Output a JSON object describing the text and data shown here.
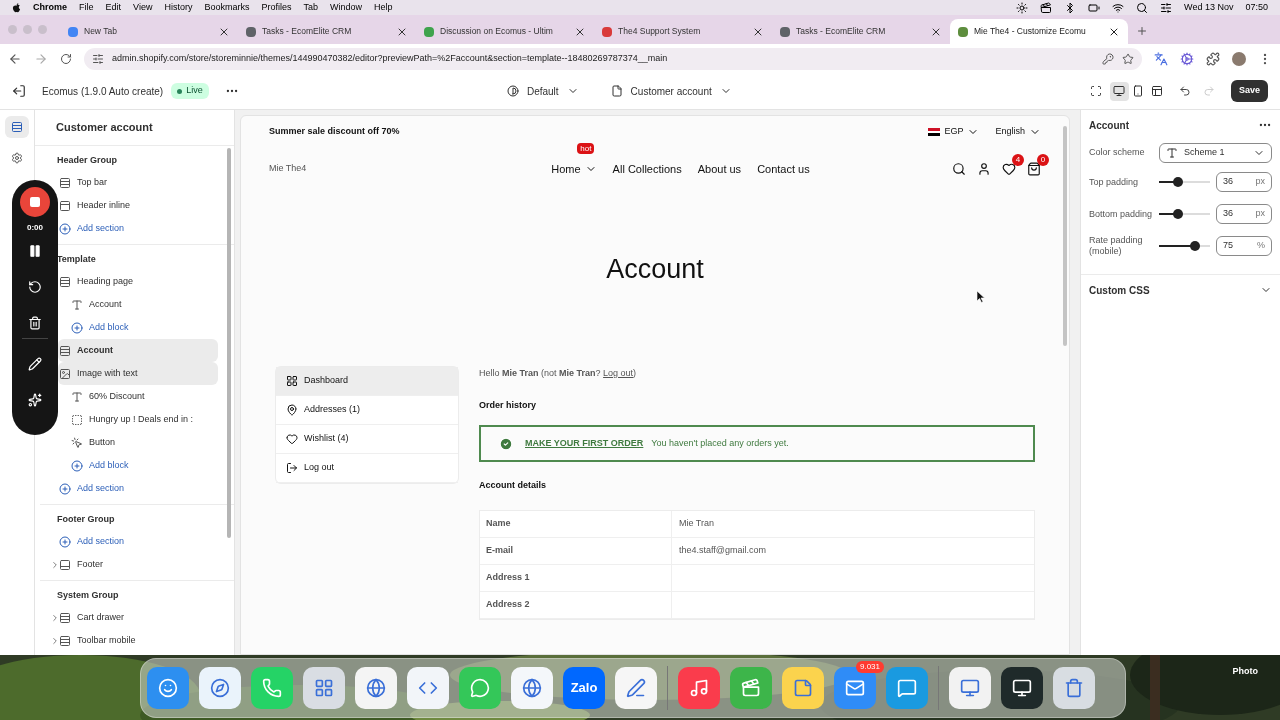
{
  "menubar": {
    "app": "Chrome",
    "menus": [
      "File",
      "Edit",
      "View",
      "History",
      "Bookmarks",
      "Profiles",
      "Tab",
      "Window",
      "Help"
    ],
    "date": "Wed 13 Nov",
    "time": "07:50"
  },
  "tabs": [
    {
      "title": "New Tab",
      "color": "#4285f4",
      "selected": false
    },
    {
      "title": "Tasks - EcomElite CRM",
      "color": "#5f6368",
      "selected": false
    },
    {
      "title": "Discussion on Ecomus - Ultim",
      "color": "#3fa34d",
      "selected": false
    },
    {
      "title": "The4 Support System",
      "color": "#d93a3a",
      "selected": false
    },
    {
      "title": "Tasks - EcomElite CRM",
      "color": "#5f6368",
      "selected": false
    },
    {
      "title": "Mie The4 - Customize Ecomu",
      "color": "#5e8e3e",
      "selected": true
    }
  ],
  "address_bar": {
    "url": "admin.shopify.com/store/storeminnie/themes/144990470382/editor?previewPath=%2Faccount&section=template--18480269787374__main"
  },
  "editor_bar": {
    "theme": "Ecomus (1.9.0 Auto create)",
    "status": "Live",
    "variant": "Default",
    "template": "Customer account",
    "save": "Save",
    "devices": [
      {
        "kind": "desktop",
        "selected": true
      },
      {
        "kind": "mobile",
        "selected": false
      },
      {
        "kind": "fullwidth",
        "selected": false
      }
    ],
    "undo": {
      "disabled": false
    },
    "redo": {
      "disabled": true
    }
  },
  "rail": [
    {
      "kind": "sections",
      "selected": true
    },
    {
      "kind": "settings",
      "selected": false
    }
  ],
  "recorder": {
    "time": "0:00"
  },
  "sidebar": {
    "title": "Customer account",
    "groups": [
      {
        "title": "Header Group",
        "items": [
          {
            "kind": "section",
            "label": "Top bar",
            "selected": false
          },
          {
            "kind": "header",
            "label": "Header inline",
            "selected": false
          },
          {
            "kind": "add",
            "label": "Add section",
            "selected": false
          }
        ]
      },
      {
        "title": "Template",
        "items": [
          {
            "kind": "section",
            "label": "Heading page",
            "selected": false,
            "children": [
              {
                "kind": "text",
                "label": "Account",
                "selected": false
              },
              {
                "kind": "add",
                "label": "Add block",
                "selected": false
              }
            ]
          },
          {
            "kind": "section",
            "label": "Account",
            "selected": true
          },
          {
            "kind": "imagetext",
            "label": "Image with text",
            "selected": true,
            "children": [
              {
                "kind": "text",
                "label": "60% Discount",
                "selected": false
              },
              {
                "kind": "timer",
                "label": "Hungry up ! Deals end in :",
                "selected": false
              },
              {
                "kind": "button",
                "label": "Button",
                "selected": false
              },
              {
                "kind": "add",
                "label": "Add block",
                "selected": false
              }
            ]
          },
          {
            "kind": "add",
            "label": "Add section",
            "selected": false
          }
        ]
      },
      {
        "title": "Footer Group",
        "items": [
          {
            "kind": "add",
            "label": "Add section",
            "selected": false
          },
          {
            "kind": "footer",
            "label": "Footer",
            "selected": false,
            "expanded": false
          }
        ]
      },
      {
        "title": "System Group",
        "items": [
          {
            "kind": "section",
            "label": "Cart drawer",
            "selected": false,
            "expanded": false
          },
          {
            "kind": "section",
            "label": "Toolbar mobile",
            "selected": false,
            "expanded": false
          }
        ]
      }
    ]
  },
  "store": {
    "announcement": "Summer sale discount off 70%",
    "currency": "EGP",
    "language": "English",
    "logo": "Mie The4",
    "nav": [
      {
        "label": "Home",
        "badge": "hot",
        "dropdown": true
      },
      {
        "label": "All Collections",
        "dropdown": false
      },
      {
        "label": "About us",
        "dropdown": false
      },
      {
        "label": "Contact us",
        "dropdown": false
      }
    ],
    "wishlist_count": "4",
    "cart_count": "0",
    "page_title": "Account",
    "account_menu": [
      {
        "kind": "dashboard",
        "label": "Dashboard",
        "selected": true
      },
      {
        "kind": "addresses",
        "label": "Addresses (1)",
        "selected": false
      },
      {
        "kind": "wishlist",
        "label": "Wishlist (4)",
        "selected": false
      },
      {
        "kind": "logout",
        "label": "Log out",
        "selected": false
      }
    ],
    "greeting": {
      "text": "Hello **Mie Tran** (not **Mie Tran**? ",
      "link": "Log out",
      "end": ")"
    },
    "order_history": {
      "title": "Order history",
      "link": "MAKE YOUR FIRST ORDER",
      "message": "You haven't placed any orders yet."
    },
    "details": {
      "title": "Account details",
      "rows": [
        {
          "label": "Name",
          "value": "Mie Tran"
        },
        {
          "label": "E-mail",
          "value": "the4.staff@gmail.com"
        },
        {
          "label": "Address 1"
        },
        {
          "label": "Address 2"
        }
      ]
    }
  },
  "settings": {
    "title": "Account",
    "color_scheme": {
      "label": "Color scheme",
      "value": "Scheme 1"
    },
    "sliders": [
      {
        "label": "Top padding",
        "value": "36",
        "unit": "px",
        "level": 0.37
      },
      {
        "label": "Bottom padding",
        "value": "36",
        "unit": "px",
        "level": 0.37
      },
      {
        "label": "Rate padding (mobile)",
        "value": "75",
        "unit": "%",
        "level": 0.7
      }
    ],
    "custom_css": {
      "label": "Custom CSS",
      "expanded": false
    }
  },
  "dock": [
    {
      "kind": "finder",
      "color": "#2d8ff0"
    },
    {
      "kind": "safari",
      "color": "#eaf3fb"
    },
    {
      "kind": "whatsapp",
      "color": "#25d366"
    },
    {
      "kind": "launchpad",
      "color": "#d9dde3"
    },
    {
      "kind": "chrome",
      "color": "#f4f4f4"
    },
    {
      "kind": "vscode",
      "color": "#f2f5f9"
    },
    {
      "kind": "messages",
      "color": "#34c759"
    },
    {
      "kind": "edge",
      "color": "#f4f7fa"
    },
    {
      "kind": "zalo",
      "color": "#0068ff",
      "label": "Zalo"
    },
    {
      "kind": "freeform",
      "color": "#f6f6f6"
    },
    {
      "kind": "separator"
    },
    {
      "kind": "music",
      "color": "#fa3c4c"
    },
    {
      "kind": "camtasia",
      "color": "#3db54a"
    },
    {
      "kind": "notes",
      "color": "#fbd34d"
    },
    {
      "kind": "mail",
      "color": "#2f8cf7",
      "badge": "9.031"
    },
    {
      "kind": "skype",
      "color": "#1a9ae0"
    },
    {
      "kind": "separator"
    },
    {
      "kind": "window",
      "color": "#f2f2f2"
    },
    {
      "kind": "window",
      "color": "#1f2a2a"
    },
    {
      "kind": "trash",
      "color": "#d8dde2"
    }
  ],
  "desktop_label": "Photo"
}
